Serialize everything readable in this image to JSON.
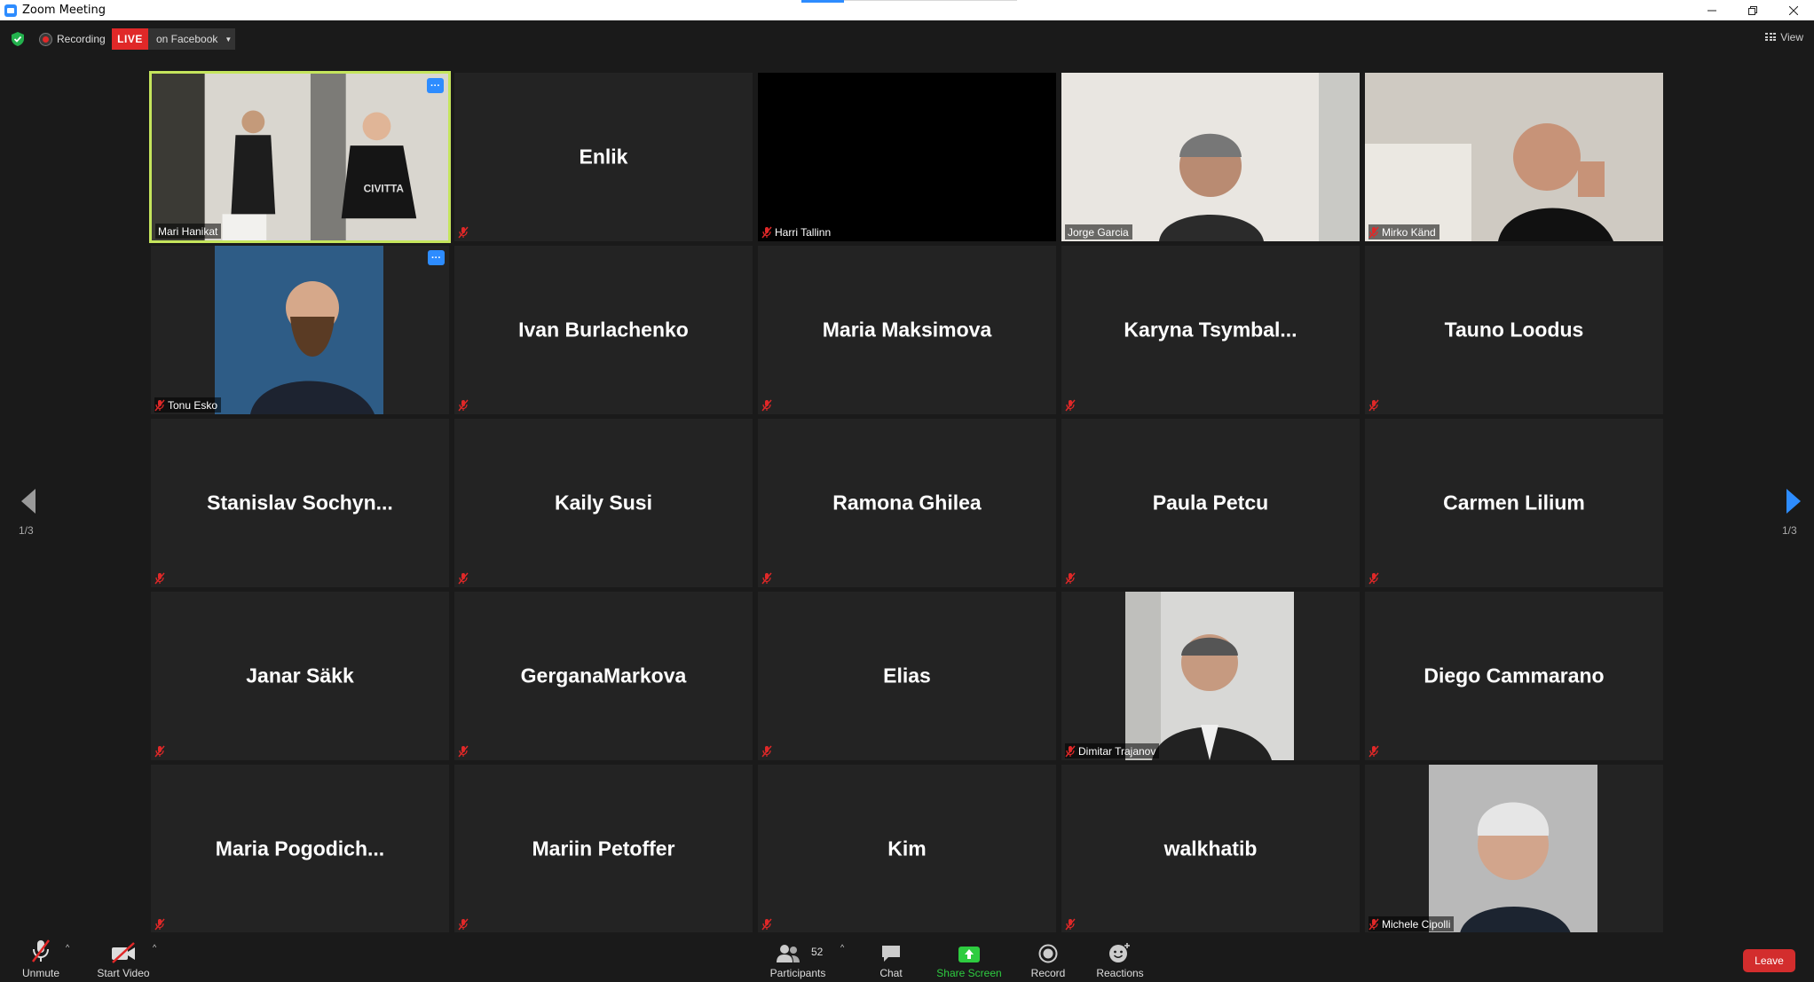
{
  "window": {
    "title": "Zoom Meeting"
  },
  "topbar": {
    "recording_label": "Recording",
    "live_label": "LIVE",
    "live_destination": "on Facebook",
    "view_label": "View"
  },
  "tiles": [
    {
      "name": "Mari Hanikat",
      "type": "video",
      "active": true,
      "show_more": true,
      "muted": false
    },
    {
      "name": "Enlik",
      "type": "name",
      "muted": true
    },
    {
      "name": "Harri Tallinn",
      "type": "black",
      "muted": true
    },
    {
      "name": "Jorge Garcia",
      "type": "video",
      "muted": false
    },
    {
      "name": "Mirko Känd",
      "type": "video",
      "muted": true
    },
    {
      "name": "Tonu Esko",
      "type": "photo",
      "show_more": true,
      "muted": true
    },
    {
      "name": "Ivan Burlachenko",
      "type": "name",
      "muted": true
    },
    {
      "name": "Maria Maksimova",
      "type": "name",
      "muted": true
    },
    {
      "name": "Karyna Tsymbal...",
      "type": "name",
      "muted": true
    },
    {
      "name": "Tauno Loodus",
      "type": "name",
      "muted": true
    },
    {
      "name": "Stanislav Sochyn...",
      "type": "name",
      "muted": true
    },
    {
      "name": "Kaily Susi",
      "type": "name",
      "muted": true
    },
    {
      "name": "Ramona Ghilea",
      "type": "name",
      "muted": true
    },
    {
      "name": "Paula Petcu",
      "type": "name",
      "muted": true
    },
    {
      "name": "Carmen Lilium",
      "type": "name",
      "muted": true
    },
    {
      "name": "Janar Säkk",
      "type": "name",
      "muted": true
    },
    {
      "name": "GerganaMarkova",
      "type": "name",
      "muted": true
    },
    {
      "name": "Elias",
      "type": "name",
      "muted": true
    },
    {
      "name": "Dimitar Trajanov",
      "type": "photo",
      "muted": true
    },
    {
      "name": "Diego Cammarano",
      "type": "name",
      "muted": true
    },
    {
      "name": "Maria Pogodich...",
      "type": "name",
      "muted": true
    },
    {
      "name": "Mariin Petoffer",
      "type": "name",
      "muted": true
    },
    {
      "name": "Kim",
      "type": "name",
      "muted": true
    },
    {
      "name": "walkhatib",
      "type": "name",
      "muted": true
    },
    {
      "name": "Michele Cipolli",
      "type": "photo",
      "muted": true
    }
  ],
  "paging": {
    "left": "1/3",
    "right": "1/3"
  },
  "toolbar": {
    "unmute": "Unmute",
    "start_video": "Start Video",
    "participants": "Participants",
    "participants_count": "52",
    "chat": "Chat",
    "share_screen": "Share Screen",
    "record": "Record",
    "reactions": "Reactions",
    "leave": "Leave"
  },
  "colors": {
    "accent_blue": "#2d8cff",
    "live_red": "#e02828",
    "active_speaker": "#c5e55c",
    "share_green": "#2ecc40",
    "leave_red": "#d32d2d"
  }
}
